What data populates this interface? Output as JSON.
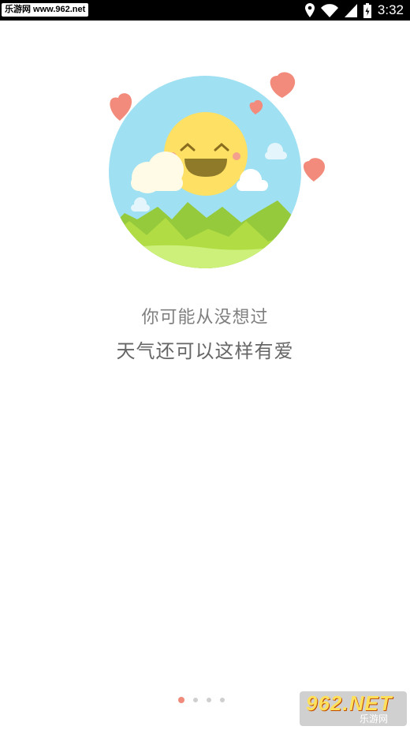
{
  "status_bar": {
    "watermark": "乐游网 www.962.net",
    "time": "3:32",
    "icons": [
      "location-icon",
      "wifi-icon",
      "signal-icon",
      "battery-icon"
    ]
  },
  "onboarding": {
    "line1": "你可能从没想过",
    "line2": "天气还可以这样有爱",
    "page_indicator": {
      "total": 4,
      "current": 1
    },
    "accent_color": "#f08a7a"
  },
  "watermark_bottom": {
    "big": "962.NET",
    "small": "乐游网"
  }
}
